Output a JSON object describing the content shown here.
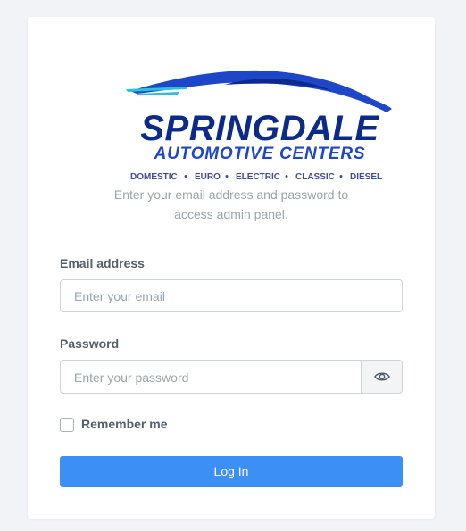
{
  "logo": {
    "brand": "SPRINGDALE",
    "subtitle": "AUTOMOTIVE CENTERS",
    "services": [
      "DOMESTIC",
      "EURO",
      "ELECTRIC",
      "CLASSIC",
      "DIESEL"
    ]
  },
  "intro": {
    "line1": "Enter your email address and password to",
    "line2": "access admin panel."
  },
  "email": {
    "label": "Email address",
    "placeholder": "Enter your email"
  },
  "password": {
    "label": "Password",
    "placeholder": "Enter your password",
    "toggle_icon": "eye-icon"
  },
  "remember": {
    "label": "Remember me",
    "checked": false
  },
  "login_button": {
    "label": "Log In"
  },
  "colors": {
    "background": "#f2f3f7",
    "primary_button": "#3b8ff5",
    "logo_navy": "#0b2a8a",
    "logo_blue": "#1e46c8",
    "logo_accent": "#2bc2d6"
  }
}
